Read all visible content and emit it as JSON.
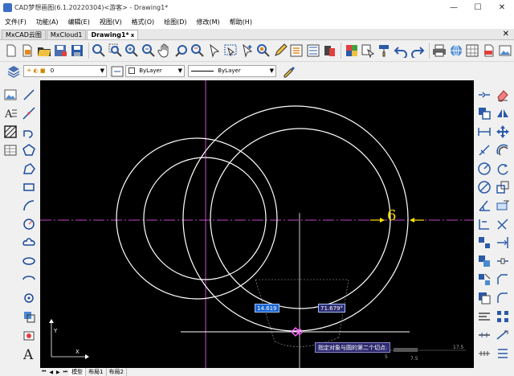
{
  "window": {
    "title": "CAD梦想画图(6.1.20220304)<游客> - Drawing1*",
    "min": "—",
    "max": "☐",
    "close": "✕"
  },
  "menu": [
    {
      "label": "文件(F)"
    },
    {
      "label": "功能(A)"
    },
    {
      "label": "编辑(E)"
    },
    {
      "label": "视图(V)"
    },
    {
      "label": "格式(O)"
    },
    {
      "label": "绘图(D)"
    },
    {
      "label": "修改(M)"
    },
    {
      "label": "帮助(H)"
    }
  ],
  "tabs": [
    {
      "label": "MxCAD云图",
      "active": false
    },
    {
      "label": "MxCloud1",
      "active": false
    },
    {
      "label": "Drawing1*",
      "active": true
    }
  ],
  "tab_close": "x",
  "properties": {
    "layer_value": "0",
    "color_value": "ByLayer",
    "linetype_value": "ByLayer"
  },
  "canvas": {
    "dimension_text": "6",
    "length_input": "14.619",
    "angle_input": "71.679°",
    "prompt_tooltip": "指定对象与圆的第二个切点:",
    "scale_labels": [
      "17.5",
      "5",
      "7.5"
    ],
    "axis_x": "X",
    "axis_y": "Y"
  },
  "layouts": [
    {
      "label": "模型",
      "active": true
    },
    {
      "label": "布局1",
      "active": false
    },
    {
      "label": "布局2",
      "active": false
    }
  ],
  "colors": {
    "canvas_bg": "#000000",
    "drawing": "#ffffff",
    "center_line": "#ff60ff",
    "dimension": "#ffe000",
    "input_box": "#1a64d0"
  }
}
